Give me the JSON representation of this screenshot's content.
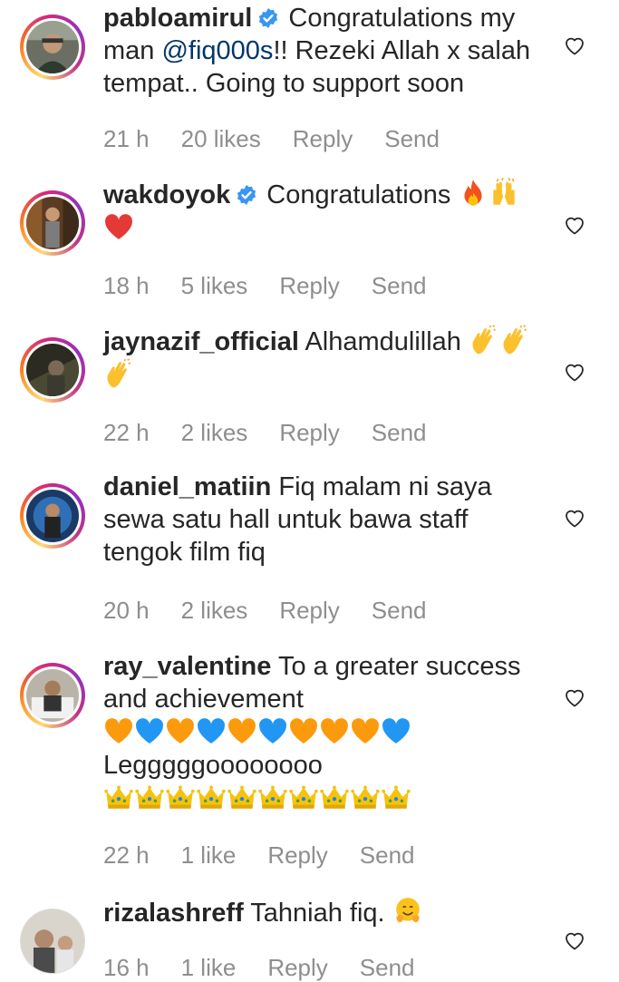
{
  "comments": [
    {
      "username": "pabloamirul",
      "verified": true,
      "text_before": "Congratulations my man ",
      "mention": "@fiq000s",
      "text_after": "!! Rezeki Allah x salah tempat.. Going to support soon",
      "time": "21 h",
      "likes": "20 likes",
      "reply": "Reply",
      "send": "Send"
    },
    {
      "username": "wakdoyok",
      "verified": true,
      "text": "Congratulations",
      "emojis": [
        "fire",
        "raising-hands",
        "red-heart"
      ],
      "time": "18 h",
      "likes": "5 likes",
      "reply": "Reply",
      "send": "Send"
    },
    {
      "username": "jaynazif_official",
      "verified": false,
      "text": "Alhamdulillah",
      "emojis": [
        "clapping-hands",
        "clapping-hands",
        "clapping-hands"
      ],
      "time": "22 h",
      "likes": "2 likes",
      "reply": "Reply",
      "send": "Send"
    },
    {
      "username": "daniel_matiin",
      "verified": false,
      "text": "Fiq malam ni saya sewa satu hall untuk bawa staff tengok film fiq",
      "time": "20 h",
      "likes": "2 likes",
      "reply": "Reply",
      "send": "Send"
    },
    {
      "username": "ray_valentine",
      "verified": false,
      "text": "To a greater success and achievement",
      "heart_emojis": [
        "orange",
        "blue",
        "orange",
        "blue",
        "orange",
        "blue",
        "orange",
        "orange",
        "orange",
        "blue"
      ],
      "text2": "Legggggoooooooo",
      "crown_count": 10,
      "time": "22 h",
      "likes": "1 like",
      "reply": "Reply",
      "send": "Send"
    },
    {
      "username": "rizalashreff",
      "verified": false,
      "text": "Tahniah fiq.",
      "emojis": [
        "hugging-face"
      ],
      "time": "16 h",
      "likes": "1 like",
      "reply": "Reply",
      "send": "Send"
    }
  ],
  "colors": {
    "text": "#262626",
    "meta": "#8e8e8e",
    "mention": "#00376b",
    "verified": "#3897f0"
  }
}
